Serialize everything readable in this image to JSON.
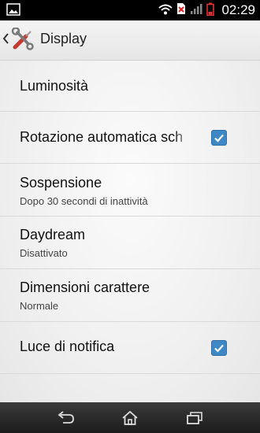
{
  "status_bar": {
    "time": "02:29",
    "icons": [
      "gallery-notification-icon",
      "wifi-icon",
      "no-sim-icon",
      "signal-icon",
      "battery-low-icon"
    ]
  },
  "action_bar": {
    "title": "Display",
    "icon": "settings-tools-icon"
  },
  "settings": [
    {
      "title": "Luminosità",
      "summary": "",
      "checkbox": null
    },
    {
      "title": "Rotazione automatica sch",
      "summary": "",
      "checkbox": true
    },
    {
      "title": "Sospensione",
      "summary": "Dopo 30 secondi di inattività",
      "checkbox": null
    },
    {
      "title": "Daydream",
      "summary": "Disattivato",
      "checkbox": null
    },
    {
      "title": "Dimensioni carattere",
      "summary": "Normale",
      "checkbox": null
    },
    {
      "title": "Luce di notifica",
      "summary": "",
      "checkbox": true
    }
  ],
  "nav_bar": {
    "buttons": [
      "back-icon",
      "home-icon",
      "recents-icon"
    ]
  },
  "colors": {
    "accent": "#3f88c6",
    "battery": "#e03030"
  }
}
